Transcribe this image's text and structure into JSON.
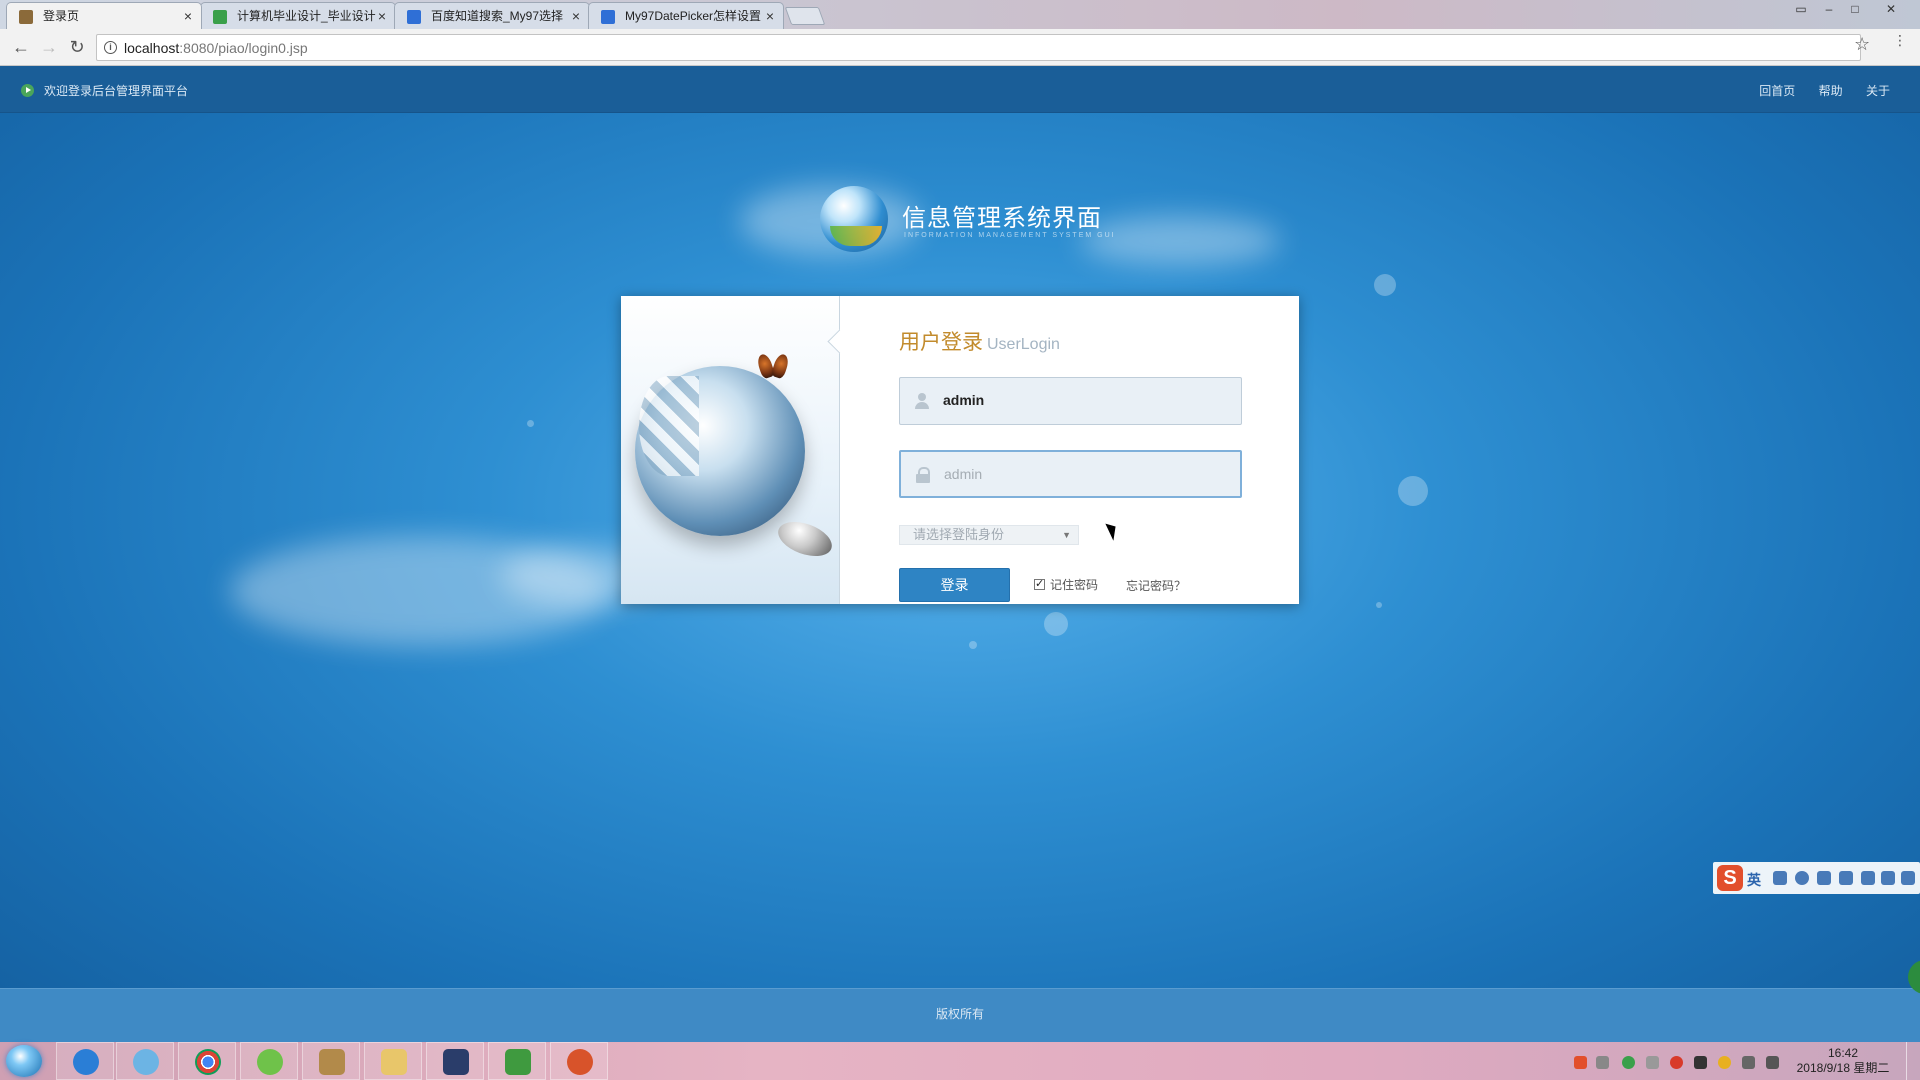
{
  "browser": {
    "tabs": [
      {
        "title": "登录页",
        "active": true
      },
      {
        "title": "计算机毕业设计_毕业设计",
        "active": false
      },
      {
        "title": "百度知道搜索_My97选择",
        "active": false
      },
      {
        "title": "My97DatePicker怎样设置",
        "active": false
      }
    ],
    "url_host": "localhost",
    "url_path": ":8080/piao/login0.jsp",
    "close_glyph": "×",
    "back_glyph": "←",
    "forward_glyph": "→",
    "reload_glyph": "↻",
    "info_glyph": "i",
    "star_glyph": "☆",
    "menu_glyph": "⋮",
    "min_glyph": "–",
    "max_glyph": "□",
    "win_close_glyph": "✕",
    "profile_glyph": "▭"
  },
  "topbar": {
    "welcome": "欢迎登录后台管理界面平台",
    "links": [
      "回首页",
      "帮助",
      "关于"
    ]
  },
  "logo": {
    "title": "信息管理系统界面",
    "subtitle": "INFORMATION MANAGEMENT SYSTEM GUI"
  },
  "login": {
    "title": "用户登录",
    "title_en": "UserLogin",
    "username_value": "admin",
    "password_placeholder": "admin",
    "role_select_value": "请选择登陆身份",
    "role_caret": "▼",
    "submit_label": "登录",
    "remember_label": "记住密码",
    "remember_checked": true,
    "forgot_label": "忘记密码？"
  },
  "footer": {
    "copyright": "版权所有"
  },
  "ime": {
    "logo": "S",
    "lang": "英"
  },
  "taskbar": {
    "apps": [
      "ie-icon",
      "app-icon",
      "chrome-icon",
      "app-icon",
      "tools-icon",
      "folder-icon",
      "app-icon",
      "app-icon",
      "app-icon"
    ],
    "clock_time": "16:42",
    "clock_date": "2018/9/18 星期二"
  },
  "colors": {
    "page_bg": "#1a6fb0",
    "topbar_bg": "#1a5e98",
    "title_gold": "#c28b2c",
    "button_blue": "#2e84c4",
    "footer_bg": "#3f8ac5"
  }
}
